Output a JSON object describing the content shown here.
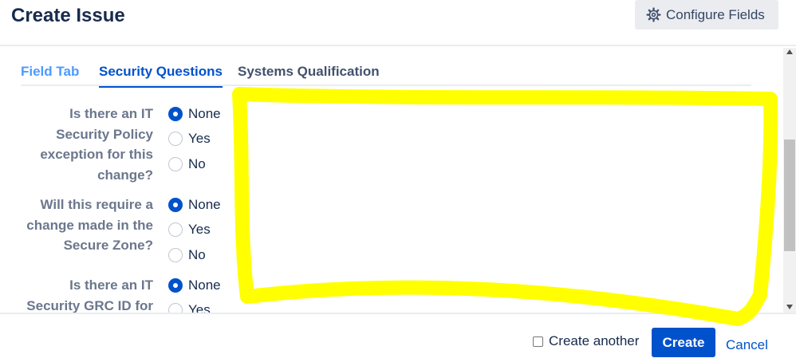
{
  "header": {
    "title": "Create Issue",
    "configure_fields_label": "Configure Fields",
    "configure_icon": "gear-icon"
  },
  "tabs": [
    {
      "label": "Field Tab",
      "active": false
    },
    {
      "label": "Security Questions",
      "active": true
    },
    {
      "label": "Systems Qualification",
      "active": false
    }
  ],
  "questions": [
    {
      "label_lines": [
        "Is there an IT",
        "Security Policy",
        "exception for this",
        "change?"
      ],
      "options": [
        "None",
        "Yes",
        "No"
      ],
      "selected": "None"
    },
    {
      "label_lines": [
        "Will this require a",
        "change made in the",
        "Secure Zone?"
      ],
      "options": [
        "None",
        "Yes",
        "No"
      ],
      "selected": "None"
    },
    {
      "label_lines": [
        "Is there an IT",
        "Security GRC ID for"
      ],
      "options": [
        "None",
        "Yes"
      ],
      "selected": "None"
    }
  ],
  "footer": {
    "create_another_label": "Create another",
    "create_another_checked": false,
    "create_label": "Create",
    "cancel_label": "Cancel"
  },
  "colors": {
    "primary": "#0052cc",
    "highlight": "#ffff00",
    "muted_text": "#6b778c"
  }
}
